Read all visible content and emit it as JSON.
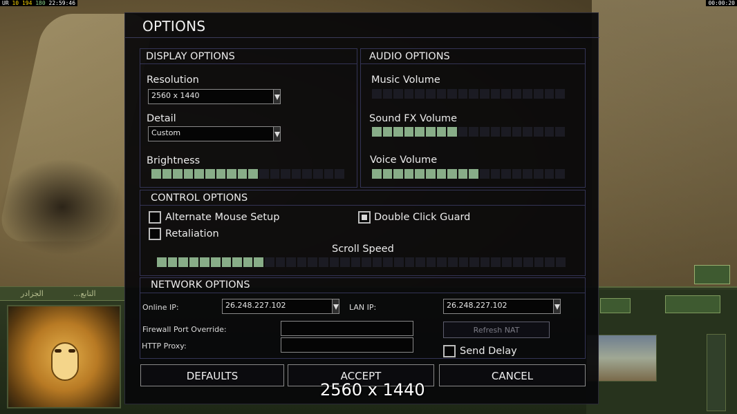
{
  "status_bar": {
    "left_segments": [
      "UR",
      "10",
      "194",
      "180",
      "22:59:46"
    ],
    "right": "00:00:20"
  },
  "hud": {
    "tab_left": "...التابع",
    "tab_mid": "الجزادر"
  },
  "dialog": {
    "title": "OPTIONS",
    "display": {
      "heading": "DISPLAY OPTIONS",
      "resolution_label": "Resolution",
      "resolution_value": "2560 x 1440",
      "detail_label": "Detail",
      "detail_value": "Custom",
      "brightness_label": "Brightness",
      "brightness_level": {
        "filled": 10,
        "total": 18
      }
    },
    "audio": {
      "heading": "AUDIO OPTIONS",
      "music_label": "Music Volume",
      "music_level": {
        "filled": 0,
        "total": 18
      },
      "sfx_label": "Sound FX Volume",
      "sfx_level": {
        "filled": 8,
        "total": 18
      },
      "voice_label": "Voice Volume",
      "voice_level": {
        "filled": 10,
        "total": 18
      }
    },
    "control": {
      "heading": "CONTROL OPTIONS",
      "alt_mouse_label": "Alternate Mouse Setup",
      "alt_mouse_checked": false,
      "double_click_label": "Double Click Guard",
      "double_click_checked": true,
      "retaliation_label": "Retaliation",
      "retaliation_checked": false,
      "scroll_label": "Scroll Speed",
      "scroll_level": {
        "filled": 10,
        "total": 38
      }
    },
    "network": {
      "heading": "NETWORK OPTIONS",
      "online_ip_label": "Online IP:",
      "online_ip_value": "26.248.227.102",
      "lan_ip_label": "LAN IP:",
      "lan_ip_value": "26.248.227.102",
      "firewall_label": "Firewall Port Override:",
      "firewall_value": "",
      "proxy_label": "HTTP Proxy:",
      "proxy_value": "",
      "refresh_nat_label": "Refresh NAT",
      "send_delay_label": "Send Delay",
      "send_delay_checked": false
    },
    "buttons": {
      "defaults": "DEFAULTS",
      "accept": "ACCEPT",
      "cancel": "CANCEL"
    }
  },
  "overlay_resolution": "2560 x 1440",
  "colors": {
    "slider_on": "#88ad88",
    "slider_off": "#1b1b23",
    "panel_border": "#343456"
  }
}
